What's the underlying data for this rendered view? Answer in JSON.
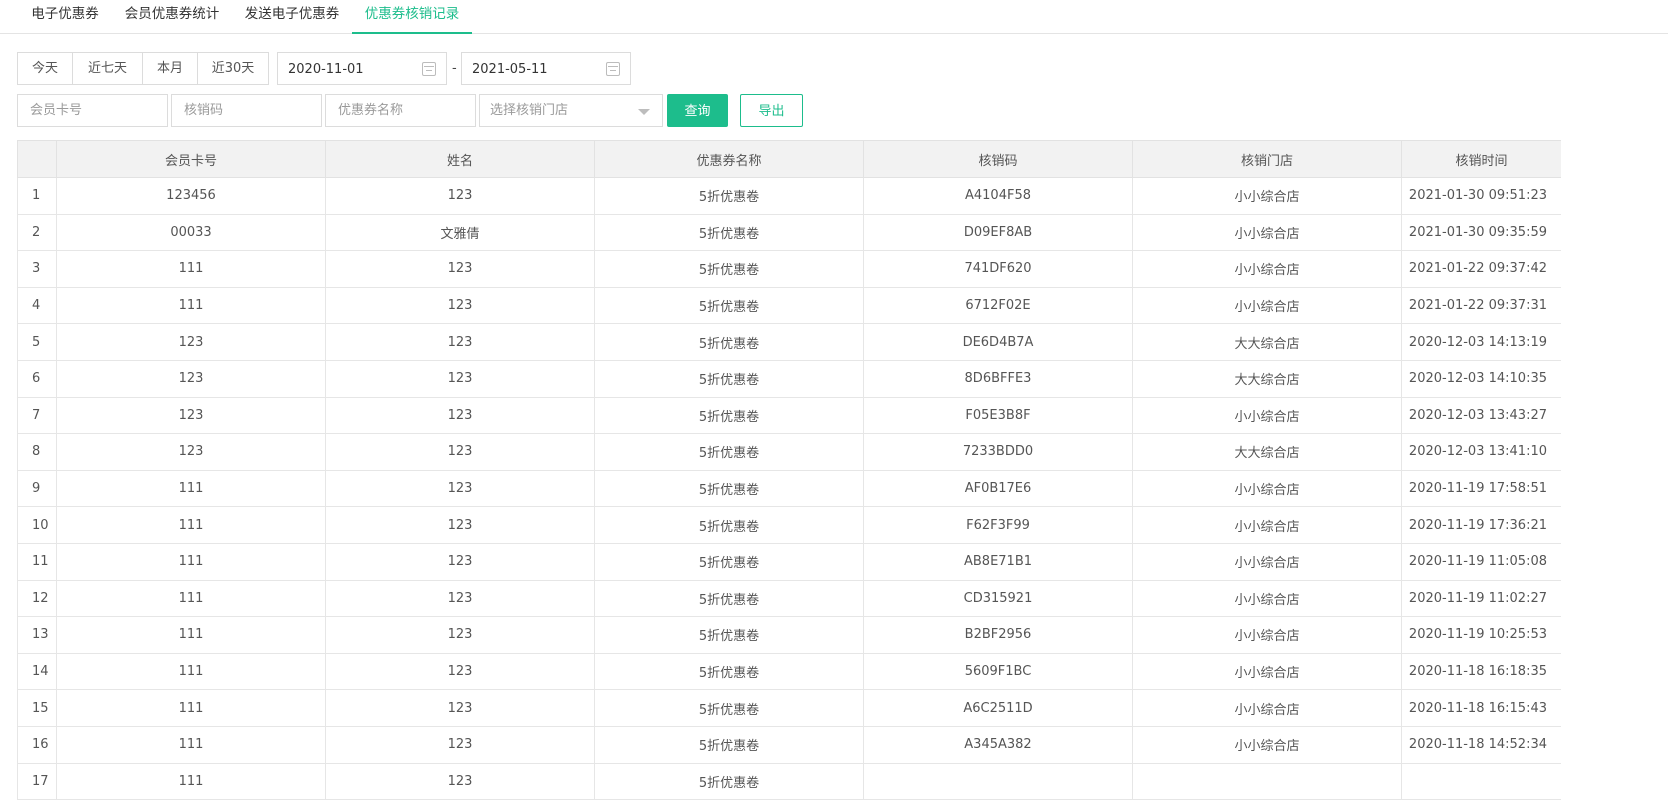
{
  "tabs": [
    {
      "label": "电子优惠券"
    },
    {
      "label": "会员优惠券统计"
    },
    {
      "label": "发送电子优惠券"
    },
    {
      "label": "优惠券核销记录",
      "active": true
    }
  ],
  "accent_color": "#1dbd8c",
  "filters": {
    "ranges": [
      "今天",
      "近七天",
      "本月",
      "近30天"
    ],
    "date_start": "2020-11-01",
    "date_separator": "-",
    "date_end": "2021-05-11",
    "card_placeholder": "会员卡号",
    "code_placeholder": "核销码",
    "coupon_placeholder": "优惠券名称",
    "store_placeholder": "选择核销门店",
    "query_label": "查询",
    "export_label": "导出"
  },
  "table": {
    "columns": [
      "",
      "会员卡号",
      "姓名",
      "优惠券名称",
      "核销码",
      "核销门店",
      "核销时间"
    ],
    "rows": [
      [
        "1",
        "123456",
        "123",
        "5折优惠卷",
        "A4104F58",
        "小小综合店",
        "2021-01-30 09:51:23"
      ],
      [
        "2",
        "00033",
        "文雅倩",
        "5折优惠卷",
        "D09EF8AB",
        "小小综合店",
        "2021-01-30 09:35:59"
      ],
      [
        "3",
        "111",
        "123",
        "5折优惠卷",
        "741DF620",
        "小小综合店",
        "2021-01-22 09:37:42"
      ],
      [
        "4",
        "111",
        "123",
        "5折优惠卷",
        "6712F02E",
        "小小综合店",
        "2021-01-22 09:37:31"
      ],
      [
        "5",
        "123",
        "123",
        "5折优惠卷",
        "DE6D4B7A",
        "大大综合店",
        "2020-12-03 14:13:19"
      ],
      [
        "6",
        "123",
        "123",
        "5折优惠卷",
        "8D6BFFE3",
        "大大综合店",
        "2020-12-03 14:10:35"
      ],
      [
        "7",
        "123",
        "123",
        "5折优惠卷",
        "F05E3B8F",
        "小小综合店",
        "2020-12-03 13:43:27"
      ],
      [
        "8",
        "123",
        "123",
        "5折优惠卷",
        "7233BDD0",
        "大大综合店",
        "2020-12-03 13:41:10"
      ],
      [
        "9",
        "111",
        "123",
        "5折优惠卷",
        "AF0B17E6",
        "小小综合店",
        "2020-11-19 17:58:51"
      ],
      [
        "10",
        "111",
        "123",
        "5折优惠卷",
        "F62F3F99",
        "小小综合店",
        "2020-11-19 17:36:21"
      ],
      [
        "11",
        "111",
        "123",
        "5折优惠卷",
        "AB8E71B1",
        "小小综合店",
        "2020-11-19 11:05:08"
      ],
      [
        "12",
        "111",
        "123",
        "5折优惠卷",
        "CD315921",
        "小小综合店",
        "2020-11-19 11:02:27"
      ],
      [
        "13",
        "111",
        "123",
        "5折优惠卷",
        "B2BF2956",
        "小小综合店",
        "2020-11-19 10:25:53"
      ],
      [
        "14",
        "111",
        "123",
        "5折优惠卷",
        "5609F1BC",
        "小小综合店",
        "2020-11-18 16:18:35"
      ],
      [
        "15",
        "111",
        "123",
        "5折优惠卷",
        "A6C2511D",
        "小小综合店",
        "2020-11-18 16:15:43"
      ],
      [
        "16",
        "111",
        "123",
        "5折优惠卷",
        "A345A382",
        "小小综合店",
        "2020-11-18 14:52:34"
      ],
      [
        "17",
        "111",
        "123",
        "5折优惠卷",
        "",
        "",
        ""
      ]
    ]
  }
}
